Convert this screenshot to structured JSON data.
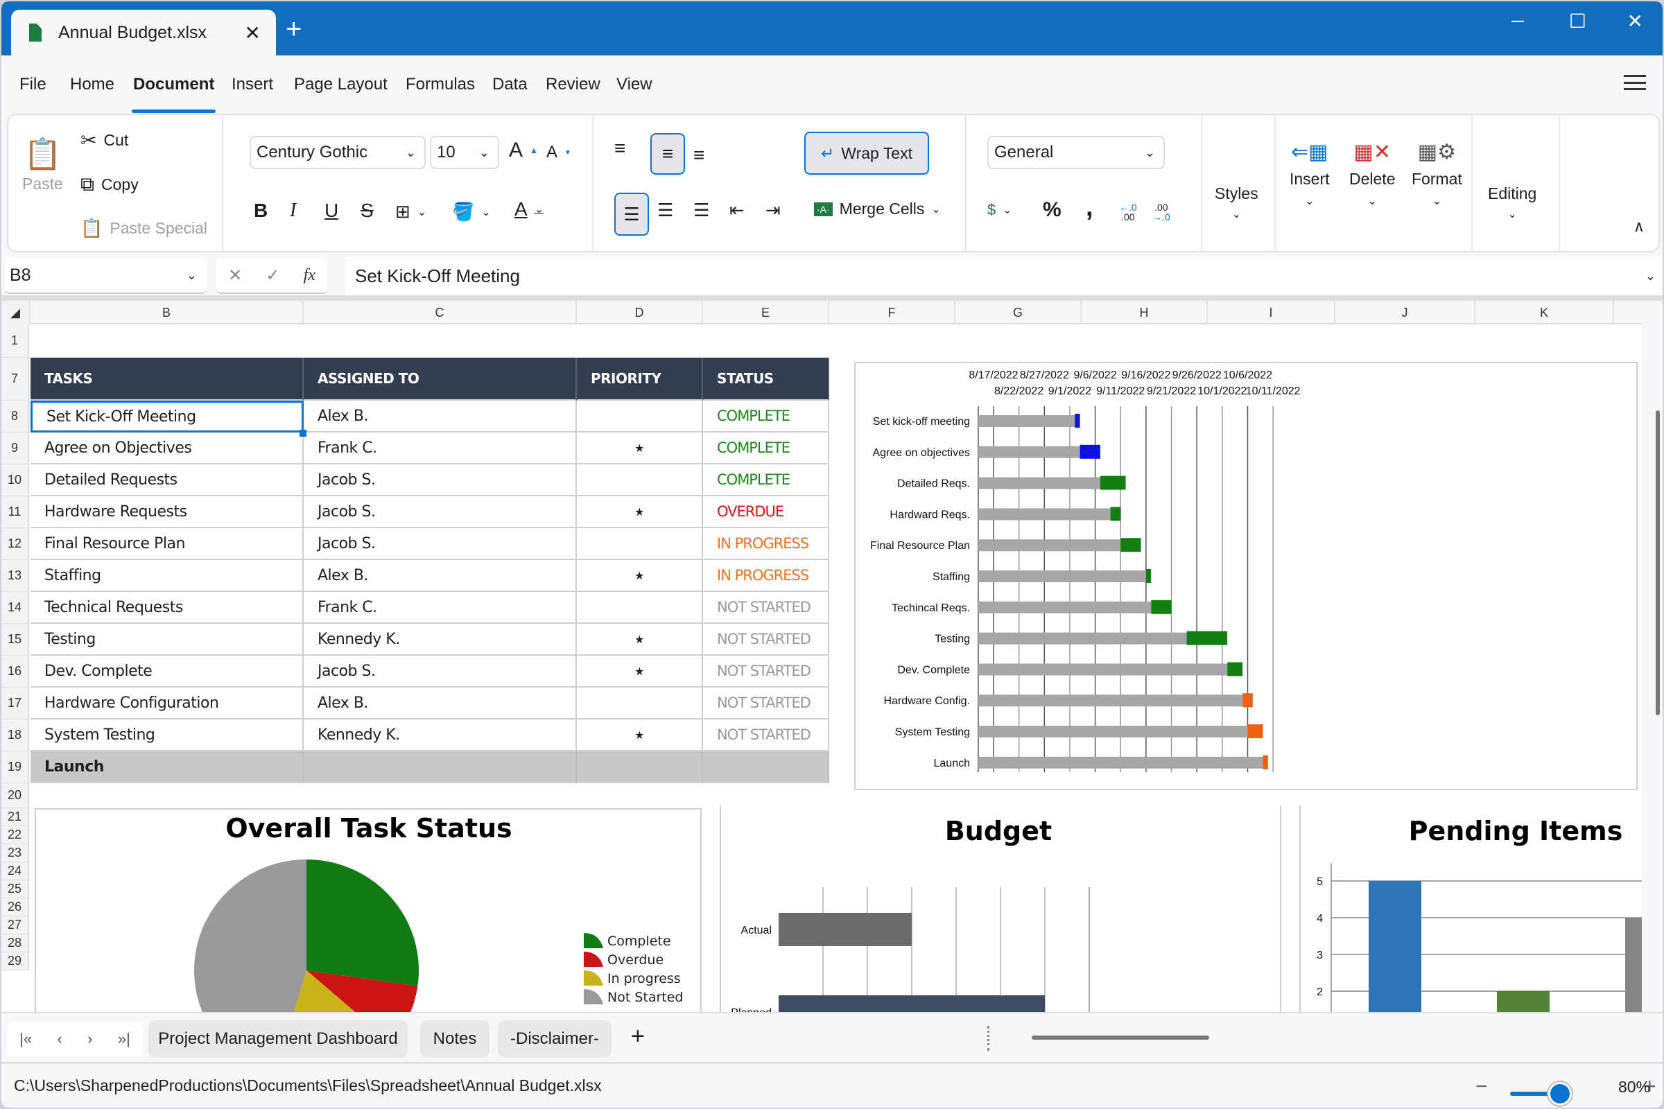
{
  "window": {
    "tab_title": "Annual Budget.xlsx",
    "new_tab": "+",
    "minimize": "–",
    "maximize": "☐",
    "close": "✕"
  },
  "menu": [
    "File",
    "Home",
    "Document",
    "Insert",
    "Page Layout",
    "Formulas",
    "Data",
    "Review",
    "View"
  ],
  "menu_active": "Document",
  "ribbon": {
    "clipboard": {
      "paste": "Paste",
      "cut": "Cut",
      "copy": "Copy",
      "paste_special": "Paste Special"
    },
    "font": {
      "name": "Century Gothic",
      "size": "10",
      "bold": "B",
      "italic": "I",
      "underline": "U",
      "strike": "S"
    },
    "alignment": {
      "wrap_text": "Wrap Text",
      "merge_cells": "Merge Cells"
    },
    "number": {
      "format": "General",
      "percent": "%",
      "comma": ","
    },
    "styles": "Styles",
    "insert": "Insert",
    "delete": "Delete",
    "format": "Format",
    "editing": "Editing"
  },
  "formula_bar": {
    "cell_ref": "B8",
    "content": "Set Kick-Off Meeting",
    "cancel": "✕",
    "enter": "✓",
    "fx": "fx"
  },
  "columns": [
    "B",
    "C",
    "D",
    "E",
    "F",
    "G",
    "H",
    "I",
    "J",
    "K"
  ],
  "row_numbers": [
    "1",
    "7",
    "8",
    "9",
    "10",
    "11",
    "12",
    "13",
    "14",
    "15",
    "16",
    "17",
    "18",
    "19",
    "20",
    "21",
    "22",
    "23",
    "24",
    "25",
    "26",
    "27",
    "28",
    "29"
  ],
  "table": {
    "headers": [
      "TASKS",
      "ASSIGNED TO",
      "PRIORITY",
      "STATUS"
    ],
    "rows": [
      {
        "task": "Set Kick-Off Meeting",
        "assigned": "Alex B.",
        "priority": "",
        "status": "COMPLETE"
      },
      {
        "task": "Agree on Objectives",
        "assigned": "Frank C.",
        "priority": "★",
        "status": "COMPLETE"
      },
      {
        "task": "Detailed Requests",
        "assigned": "Jacob S.",
        "priority": "",
        "status": "COMPLETE"
      },
      {
        "task": "Hardware Requests",
        "assigned": "Jacob S.",
        "priority": "★",
        "status": "OVERDUE"
      },
      {
        "task": "Final Resource Plan",
        "assigned": "Jacob S.",
        "priority": "",
        "status": "IN PROGRESS"
      },
      {
        "task": "Staffing",
        "assigned": "Alex B.",
        "priority": "★",
        "status": "IN PROGRESS"
      },
      {
        "task": "Technical Requests",
        "assigned": "Frank C.",
        "priority": "",
        "status": "NOT STARTED"
      },
      {
        "task": "Testing",
        "assigned": "Kennedy K.",
        "priority": "★",
        "status": "NOT STARTED"
      },
      {
        "task": "Dev. Complete",
        "assigned": "Jacob S.",
        "priority": "★",
        "status": "NOT STARTED"
      },
      {
        "task": "Hardware Configuration",
        "assigned": "Alex B.",
        "priority": "",
        "status": "NOT STARTED"
      },
      {
        "task": "System Testing",
        "assigned": "Kennedy K.",
        "priority": "★",
        "status": "NOT STARTED"
      }
    ],
    "footer": "Launch",
    "status_colors": {
      "COMPLETE": "#1a8a1a",
      "OVERDUE": "#e01010",
      "IN PROGRESS": "#f07020",
      "NOT STARTED": "#9a9a9a"
    }
  },
  "chart_data": [
    {
      "type": "bar",
      "subtype": "gantt",
      "title": "",
      "x_start": "2022-08-14",
      "x_ticks_top": [
        "8/17/2022",
        "8/27/2022",
        "9/6/2022",
        "9/16/2022",
        "9/26/2022",
        "10/6/2022"
      ],
      "x_ticks_bottom": [
        "8/22/2022",
        "9/1/2022",
        "9/11/2022",
        "9/21/2022",
        "10/1/2022",
        "10/11/2022"
      ],
      "tasks": [
        {
          "label": "Set kick-off meeting",
          "start_day": 19,
          "duration": 1,
          "color": "#1010e0"
        },
        {
          "label": "Agree on objectives",
          "start_day": 20,
          "duration": 4,
          "color": "#1010e0"
        },
        {
          "label": "Detailed Reqs.",
          "start_day": 24,
          "duration": 5,
          "color": "#118011"
        },
        {
          "label": "Hardward Reqs.",
          "start_day": 26,
          "duration": 2,
          "color": "#118011"
        },
        {
          "label": "Final Resource Plan",
          "start_day": 28,
          "duration": 4,
          "color": "#118011"
        },
        {
          "label": "Staffing",
          "start_day": 33,
          "duration": 1,
          "color": "#118011"
        },
        {
          "label": "Techincal Reqs.",
          "start_day": 34,
          "duration": 4,
          "color": "#118011"
        },
        {
          "label": "Testing",
          "start_day": 41,
          "duration": 8,
          "color": "#118011"
        },
        {
          "label": "Dev. Complete",
          "start_day": 49,
          "duration": 3,
          "color": "#118011"
        },
        {
          "label": "Hardware Config.",
          "start_day": 52,
          "duration": 2,
          "color": "#f06010"
        },
        {
          "label": "System Testing",
          "start_day": 53,
          "duration": 3,
          "color": "#f06010"
        },
        {
          "label": "Launch",
          "start_day": 56,
          "duration": 1,
          "color": "#f06010"
        }
      ]
    },
    {
      "type": "pie",
      "title": "Overall Task Status",
      "slices": [
        {
          "label": "Complete",
          "value": 3,
          "color": "#127a12"
        },
        {
          "label": "Overdue",
          "value": 1,
          "color": "#cc1414"
        },
        {
          "label": "In progress",
          "value": 2,
          "color": "#c8b418"
        },
        {
          "label": "Not Started",
          "value": 5,
          "color": "#9a9a9a"
        }
      ],
      "legend": "right"
    },
    {
      "type": "bar",
      "orientation": "horizontal",
      "title": "Budget",
      "categories": [
        "Actual",
        "Planned"
      ],
      "values": [
        3,
        6
      ],
      "xlim": [
        0,
        7
      ],
      "colors": [
        "#6a6a6a",
        "#3e4b60"
      ]
    },
    {
      "type": "bar",
      "title": "Pending Items",
      "categories": [
        "",
        "",
        ""
      ],
      "values": [
        5,
        2,
        4
      ],
      "ylim": [
        1,
        5.5
      ],
      "y_ticks": [
        "2",
        "3",
        "4",
        "5"
      ],
      "colors": [
        "#2e74b5",
        "#548235",
        "#878787"
      ]
    }
  ],
  "sheet_tabs": {
    "nav": [
      "|«",
      "‹",
      "›",
      "»|"
    ],
    "tabs": [
      "Project Management Dashboard",
      "Notes",
      "-Disclaimer-"
    ],
    "add": "+"
  },
  "status": {
    "path": "C:\\Users\\SharpenedProductions\\Documents\\Files\\Spreadsheet\\Annual Budget.xlsx",
    "zoom": "80%",
    "zoom_level": 0.4,
    "zoom_minus": "−",
    "zoom_plus": "+"
  }
}
